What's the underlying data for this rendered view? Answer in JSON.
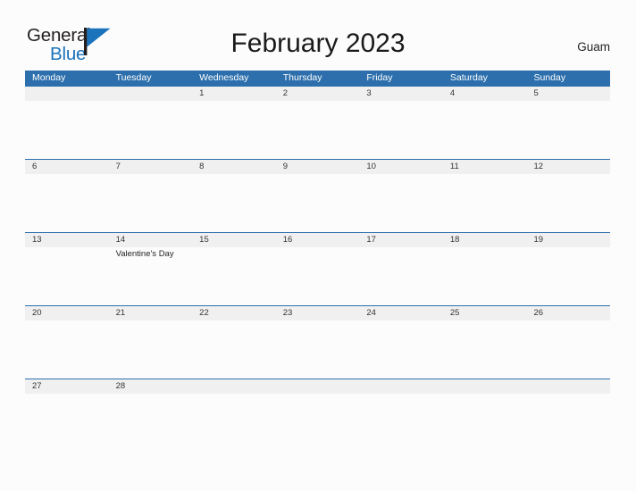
{
  "brand": {
    "name_part1": "General",
    "name_part2": "Blue",
    "flag_icon": "blue-flag-triangle-icon",
    "accent_color": "#1a73bb"
  },
  "header": {
    "title": "February 2023",
    "location": "Guam"
  },
  "theme": {
    "header_blue": "#2c6fac",
    "band_gray": "#f0f0f0",
    "page_background": "#fcfcfd",
    "text_dark": "#231f20"
  },
  "calendar": {
    "month": "February",
    "year": "2023",
    "week_start": "Monday",
    "weekdays": [
      "Monday",
      "Tuesday",
      "Wednesday",
      "Thursday",
      "Friday",
      "Saturday",
      "Sunday"
    ],
    "weeks": [
      {
        "days": [
          {
            "num": "",
            "event": ""
          },
          {
            "num": "",
            "event": ""
          },
          {
            "num": "1",
            "event": ""
          },
          {
            "num": "2",
            "event": ""
          },
          {
            "num": "3",
            "event": ""
          },
          {
            "num": "4",
            "event": ""
          },
          {
            "num": "5",
            "event": ""
          }
        ]
      },
      {
        "days": [
          {
            "num": "6",
            "event": ""
          },
          {
            "num": "7",
            "event": ""
          },
          {
            "num": "8",
            "event": ""
          },
          {
            "num": "9",
            "event": ""
          },
          {
            "num": "10",
            "event": ""
          },
          {
            "num": "11",
            "event": ""
          },
          {
            "num": "12",
            "event": ""
          }
        ]
      },
      {
        "days": [
          {
            "num": "13",
            "event": ""
          },
          {
            "num": "14",
            "event": "Valentine's Day"
          },
          {
            "num": "15",
            "event": ""
          },
          {
            "num": "16",
            "event": ""
          },
          {
            "num": "17",
            "event": ""
          },
          {
            "num": "18",
            "event": ""
          },
          {
            "num": "19",
            "event": ""
          }
        ]
      },
      {
        "days": [
          {
            "num": "20",
            "event": ""
          },
          {
            "num": "21",
            "event": ""
          },
          {
            "num": "22",
            "event": ""
          },
          {
            "num": "23",
            "event": ""
          },
          {
            "num": "24",
            "event": ""
          },
          {
            "num": "25",
            "event": ""
          },
          {
            "num": "26",
            "event": ""
          }
        ]
      },
      {
        "days": [
          {
            "num": "27",
            "event": ""
          },
          {
            "num": "28",
            "event": ""
          },
          {
            "num": "",
            "event": ""
          },
          {
            "num": "",
            "event": ""
          },
          {
            "num": "",
            "event": ""
          },
          {
            "num": "",
            "event": ""
          },
          {
            "num": "",
            "event": ""
          }
        ]
      }
    ]
  }
}
